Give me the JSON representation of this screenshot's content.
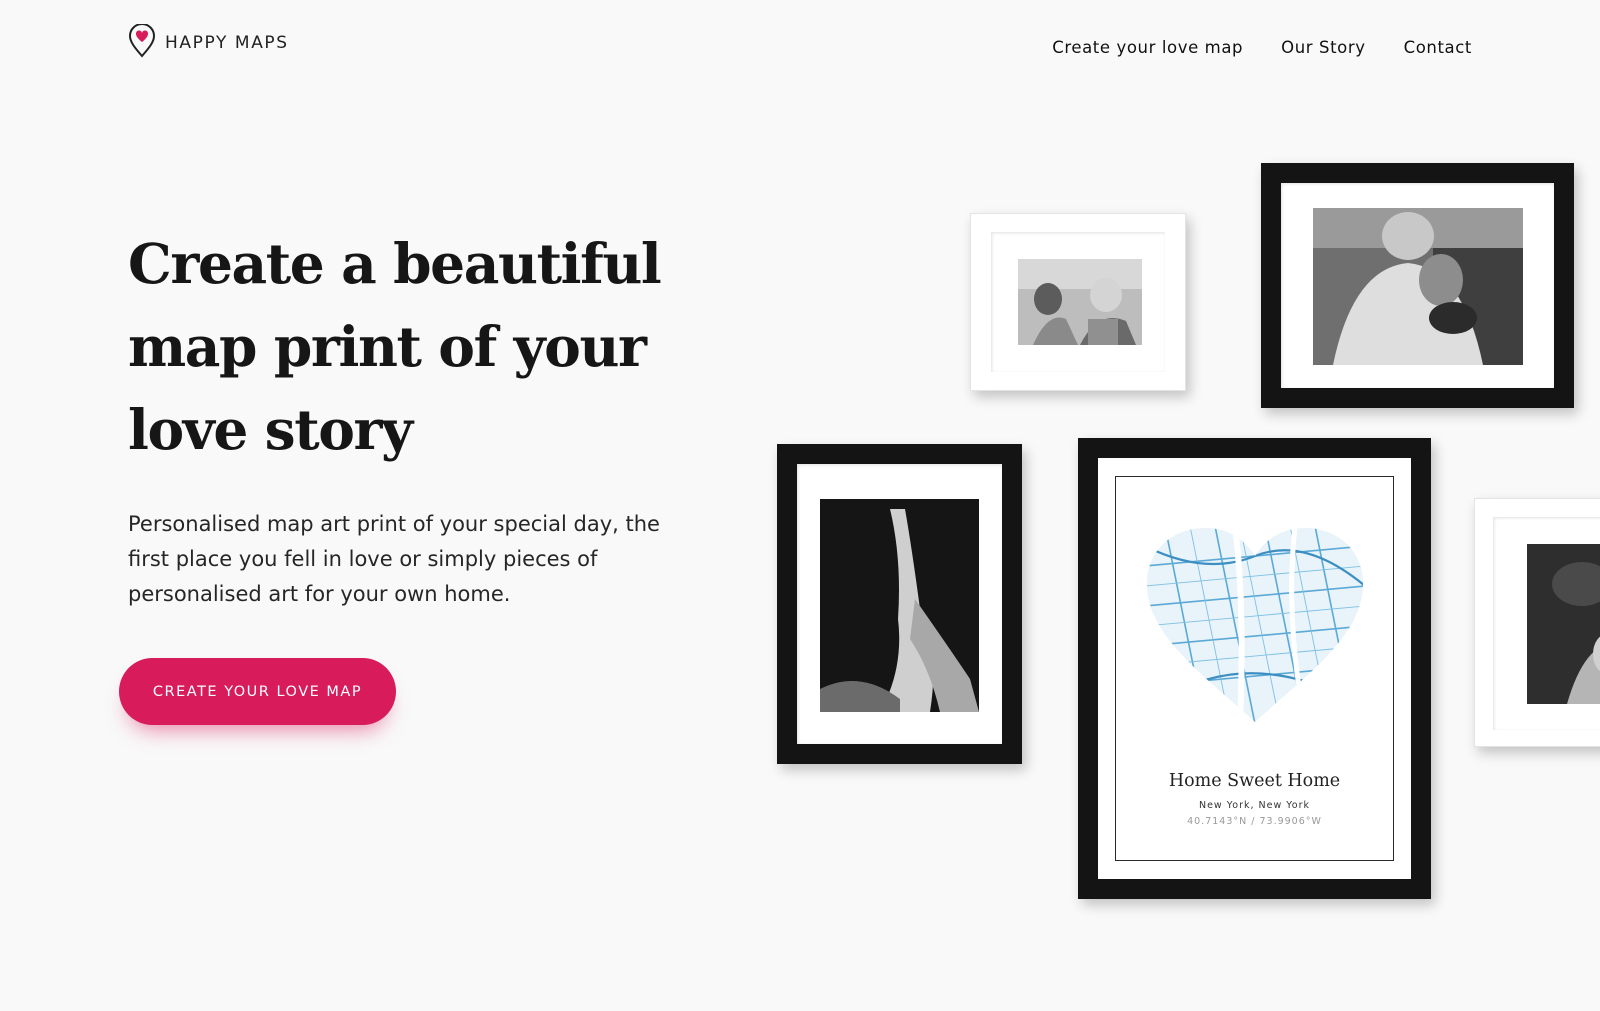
{
  "brand": {
    "name": "HAPPY MAPS",
    "accent_color": "#d81b5a",
    "logo_icon": "map-pin-heart-icon"
  },
  "nav": {
    "items": [
      {
        "label": "Create your love map"
      },
      {
        "label": "Our Story"
      },
      {
        "label": "Contact"
      }
    ]
  },
  "hero": {
    "headline": "Create a beautiful map print of your love story",
    "subtext": "Personalised map art print of your special day, the first place you fell in love or simply pieces of personalised art for your own home.",
    "cta_label": "CREATE YOUR LOVE MAP"
  },
  "gallery": {
    "map_print": {
      "title": "Home Sweet Home",
      "location": "New York, New York",
      "coordinates": "40.7143°N / 73.9906°W",
      "map_color": "#5aa9d6"
    }
  }
}
